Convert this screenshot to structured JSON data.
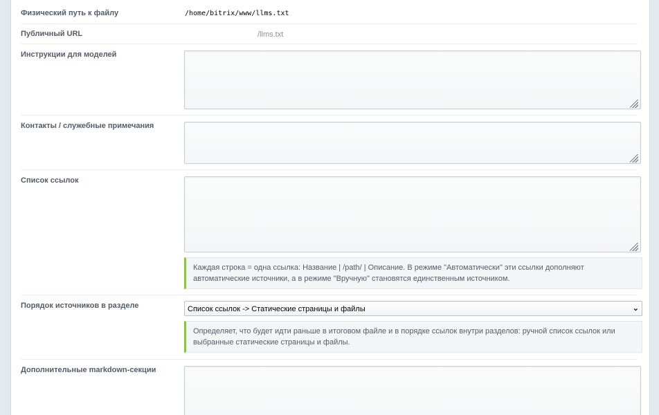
{
  "fields": {
    "file_path": {
      "label": "Физический путь к файлу",
      "value": "/home/bitrix/www/llms.txt"
    },
    "public_url": {
      "label": "Публичный URL",
      "value": "/llms.txt"
    },
    "instructions": {
      "label": "Инструкции для моделей",
      "value": ""
    },
    "contacts": {
      "label": "Контакты / служебные примечания",
      "value": ""
    },
    "links": {
      "label": "Список ссылок",
      "value": "",
      "hint": "Каждая строка = одна ссылка: Название | /path/ | Описание. В режиме \"Автоматически\" эти ссылки дополняют автоматические источники, а в режиме \"Вручную\" становятся единственным источником."
    },
    "source_order": {
      "label": "Порядок источников в разделе",
      "selected": "Список ссылок -> Статические страницы и файлы",
      "hint": "Определяет, что будет идти раньше в итоговом файле и в порядке ссылок внутри разделов: ручной список ссылок или выбранные статические страницы и файлы."
    },
    "markdown_sections": {
      "label": "Дополнительные markdown-секции",
      "value": ""
    }
  },
  "icons": {
    "resize": "resize-grip-icon",
    "select_arrow": "chevron-down-icon"
  },
  "colors": {
    "hint_accent": "#8bc34a",
    "label": "#535c69",
    "page_bg": "#e3e9ed"
  }
}
